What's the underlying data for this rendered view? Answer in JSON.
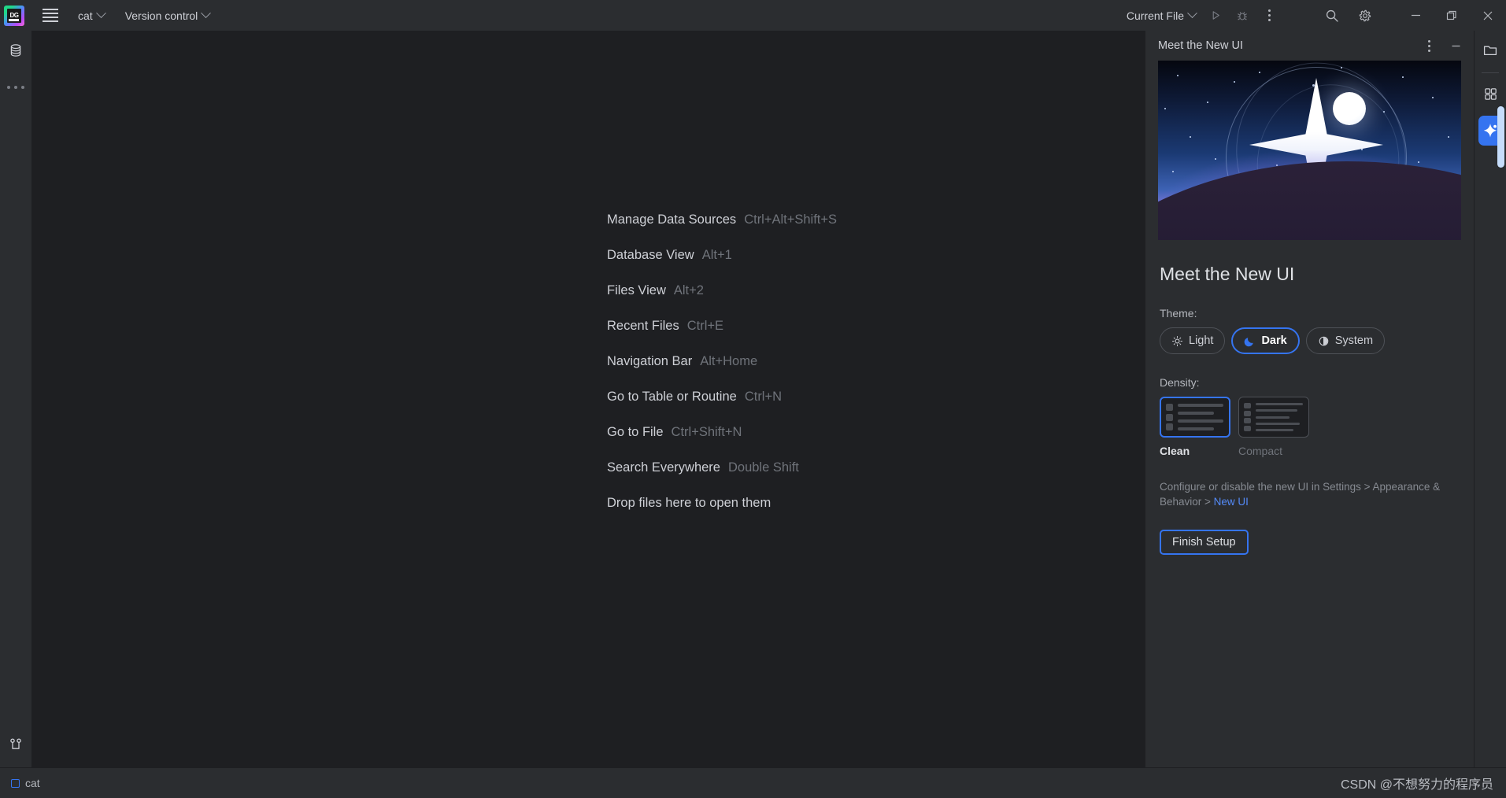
{
  "toolbar": {
    "project_name": "cat",
    "version_control_label": "Version control",
    "run_config_label": "Current File",
    "icons": [
      "app-logo",
      "main-menu",
      "run",
      "debug",
      "more-actions",
      "search",
      "settings",
      "minimize",
      "maximize",
      "close"
    ]
  },
  "left_stripe": {
    "items": [
      {
        "name": "database-tool-window",
        "icon": "database-icon"
      },
      {
        "name": "more-tool-windows",
        "icon": "more-horizontal-icon"
      }
    ],
    "bottom": {
      "name": "version-control-tool-window",
      "icon": "git-branch-icon"
    }
  },
  "right_stripe": {
    "items": [
      {
        "name": "project-files-tool-window",
        "icon": "folder-icon"
      },
      {
        "name": "plugins-tool-window",
        "icon": "grid-icon"
      },
      {
        "name": "ai-assistant-tool-window",
        "icon": "sparkle-icon"
      }
    ]
  },
  "editor": {
    "shortcuts": [
      {
        "label": "Manage Data Sources",
        "key": "Ctrl+Alt+Shift+S"
      },
      {
        "label": "Database View",
        "key": "Alt+1"
      },
      {
        "label": "Files View",
        "key": "Alt+2"
      },
      {
        "label": "Recent Files",
        "key": "Ctrl+E"
      },
      {
        "label": "Navigation Bar",
        "key": "Alt+Home"
      },
      {
        "label": "Go to Table or Routine",
        "key": "Ctrl+N"
      },
      {
        "label": "Go to File",
        "key": "Ctrl+Shift+N"
      },
      {
        "label": "Search Everywhere",
        "key": "Double Shift"
      },
      {
        "label": "Drop files here to open them",
        "key": ""
      }
    ]
  },
  "panel": {
    "title": "Meet the New UI",
    "options_icon": "more-vertical-icon",
    "minimize_icon": "minimize-icon",
    "heading": "Meet the New UI",
    "theme_label": "Theme:",
    "themes": [
      {
        "label": "Light",
        "icon": "sun-icon",
        "selected": false
      },
      {
        "label": "Dark",
        "icon": "moon-icon",
        "selected": true
      },
      {
        "label": "System",
        "icon": "contrast-icon",
        "selected": false
      }
    ],
    "density_label": "Density:",
    "densities": [
      {
        "label": "Clean",
        "selected": true
      },
      {
        "label": "Compact",
        "selected": false
      }
    ],
    "help_text_before": "Configure or disable the new UI in Settings > Appearance & Behavior > ",
    "help_link": "New UI",
    "finish_label": "Finish Setup"
  },
  "statusbar": {
    "project": "cat",
    "watermark": "CSDN @不想努力的程序员"
  },
  "colors": {
    "accent": "#3574f0",
    "link": "#548af7",
    "panel_bg": "#2b2d30",
    "editor_bg": "#1e1f22",
    "text": "#ced0d6",
    "muted": "#6f737a"
  }
}
